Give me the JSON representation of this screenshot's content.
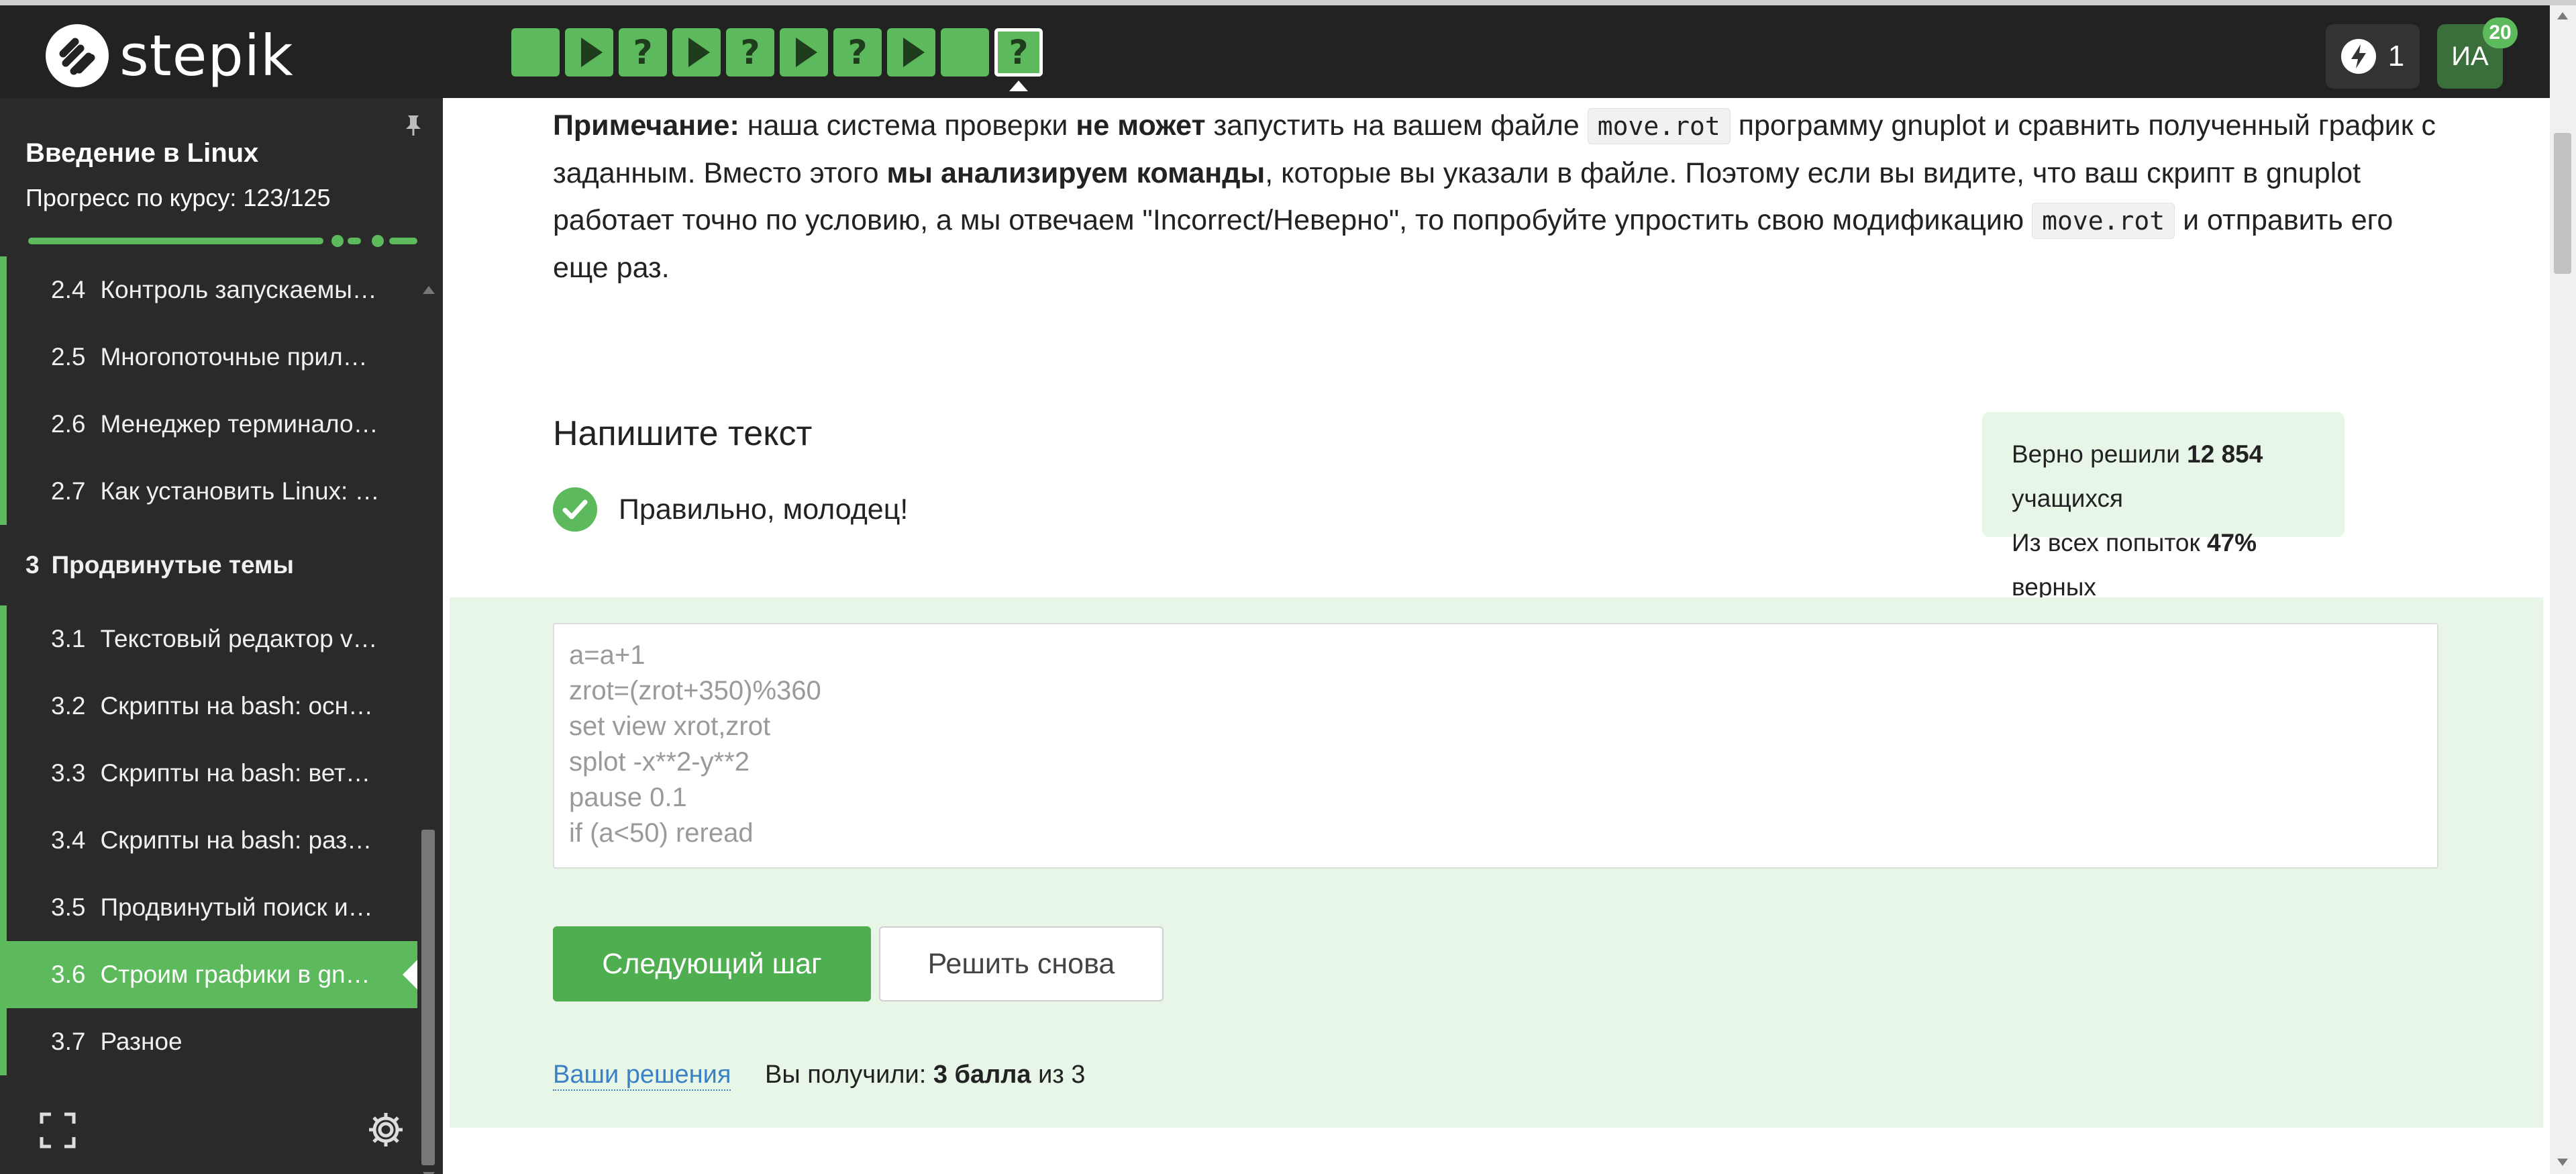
{
  "header": {
    "logo_text": "stepik",
    "steps": [
      {
        "kind": "text"
      },
      {
        "kind": "video"
      },
      {
        "kind": "quiz"
      },
      {
        "kind": "video"
      },
      {
        "kind": "quiz"
      },
      {
        "kind": "video"
      },
      {
        "kind": "quiz"
      },
      {
        "kind": "video"
      },
      {
        "kind": "text"
      },
      {
        "kind": "quiz",
        "current": true
      }
    ],
    "energy_count": "1",
    "avatar_initials": "ИА",
    "notification_count": "20"
  },
  "sidebar": {
    "course_title": "Введение в Linux",
    "progress_label": "Прогресс по курсу:  123/125",
    "lessons": [
      {
        "num": "2.4",
        "title": "Контроль запускаемы…"
      },
      {
        "num": "2.5",
        "title": "Многопоточные прил…"
      },
      {
        "num": "2.6",
        "title": "Менеджер терминало…"
      },
      {
        "num": "2.7",
        "title": "Как установить Linux: …"
      },
      {
        "num": "3",
        "title": "Продвинутые темы",
        "section": true
      },
      {
        "num": "3.1",
        "title": "Текстовый редактор v…"
      },
      {
        "num": "3.2",
        "title": "Скрипты на bash: осн…"
      },
      {
        "num": "3.3",
        "title": "Скрипты на bash: вет…"
      },
      {
        "num": "3.4",
        "title": "Скрипты на bash: раз…"
      },
      {
        "num": "3.5",
        "title": "Продвинутый поиск и…"
      },
      {
        "num": "3.6",
        "title": "Строим графики в gn…",
        "active": true
      },
      {
        "num": "3.7",
        "title": "Разное"
      }
    ]
  },
  "main": {
    "note": {
      "label": "Примечание:",
      "t1": " наша система проверки ",
      "b1": "не может",
      "t2": " запустить на вашем файле ",
      "code1": "move.rot",
      "t3": " программу gnuplot и сравнить полученный график с заданным. Вместо этого ",
      "b2": "мы анализируем команды",
      "t4": ", которые вы указали в файле. Поэтому если вы видите, что ваш скрипт в gnuplot работает точно по условию, а мы отвечаем \"Incorrect/Неверно\", то попробуйте упростить свою модификацию ",
      "code2": "move.rot",
      "t5": " и отправить его еще раз."
    },
    "task_title": "Напишите текст",
    "status_text": "Правильно, молодец!",
    "stats": {
      "solved_prefix": "Верно решили ",
      "solved_count": "12 854",
      "solved_suffix": " учащихся",
      "attempts_prefix": "Из всех попыток ",
      "attempts_percent": "47%",
      "attempts_suffix": " верных"
    },
    "answer_text": "a=a+1\nzrot=(zrot+350)%360\nset view xrot,zrot\nsplot -x**2-y**2\npause 0.1\nif (a<50) reread",
    "next_button": "Следующий шаг",
    "retry_button": "Решить снова",
    "solutions_link": "Ваши решения",
    "score_prefix": "Вы получили: ",
    "score_value": "3 балла",
    "score_suffix": " из 3"
  },
  "colors": {
    "accent": "#5cb95c",
    "header_bg": "#222222",
    "sidebar_bg": "#2a2a2a",
    "answer_bg": "#e8f6e8",
    "link": "#3b82c4"
  }
}
